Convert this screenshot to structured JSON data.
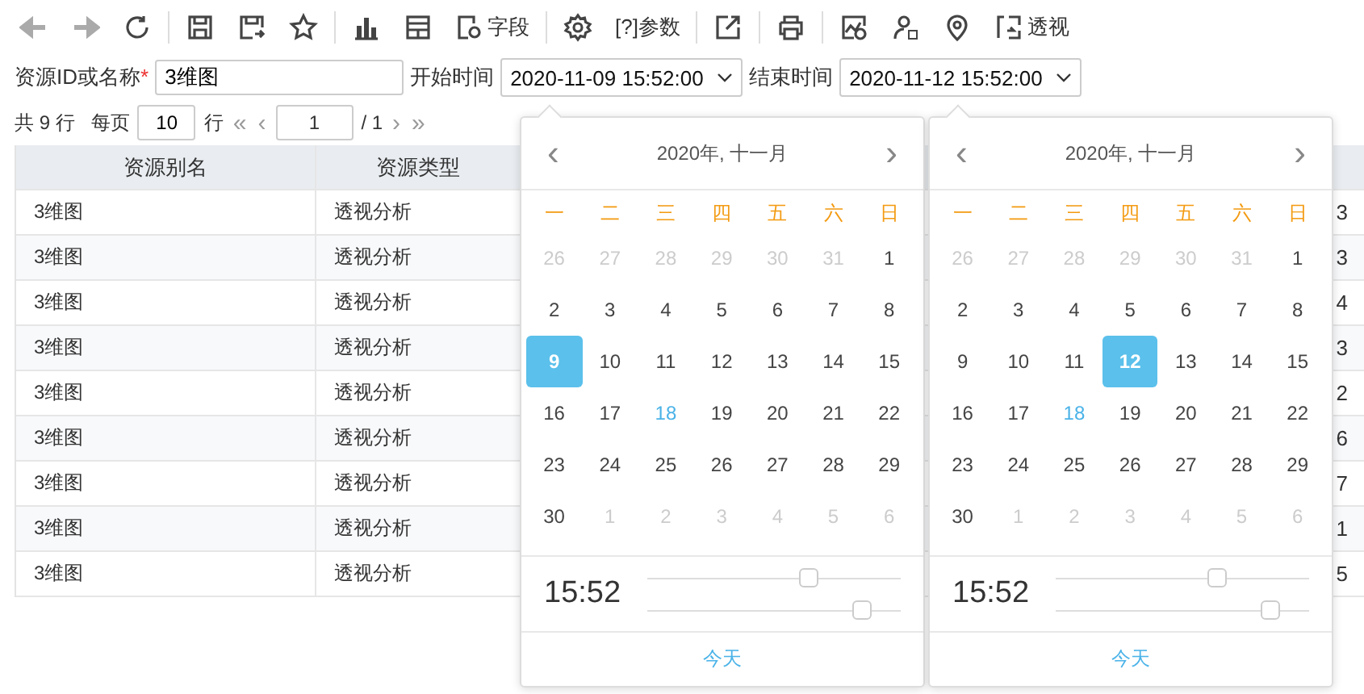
{
  "toolbar": [
    {
      "kind": "back",
      "disabled": true
    },
    {
      "kind": "forward",
      "disabled": true
    },
    {
      "kind": "refresh",
      "disabled": false
    },
    {
      "kind": "save",
      "disabled": false
    },
    {
      "kind": "save-as",
      "disabled": false
    },
    {
      "kind": "star",
      "disabled": false
    },
    {
      "kind": "bar-chart",
      "disabled": false
    },
    {
      "kind": "layout",
      "disabled": false
    },
    {
      "kind": "fields",
      "label": "字段",
      "disabled": false
    },
    {
      "kind": "gear",
      "disabled": false
    },
    {
      "kind": "params",
      "label": "[?]参数",
      "disabled": false
    },
    {
      "kind": "export",
      "disabled": false
    },
    {
      "kind": "print",
      "disabled": false
    },
    {
      "kind": "chart-clock",
      "disabled": false
    },
    {
      "kind": "user-help",
      "disabled": false
    },
    {
      "kind": "pin",
      "disabled": false
    },
    {
      "kind": "pivot",
      "label": "透视",
      "disabled": false
    }
  ],
  "filters": {
    "name_label": "资源ID或名称",
    "required_mark": "*",
    "name_value": "3维图",
    "start_label": "开始时间",
    "start_value": "2020-11-09 15:52:00",
    "end_label": "结束时间",
    "end_value": "2020-11-12 15:52:00"
  },
  "pager": {
    "total": "共 9 行",
    "per_page_label": "每页",
    "per_page": "10",
    "rows_label": "行",
    "first": "«",
    "prev": "‹",
    "page": "1",
    "of": "/ 1",
    "next": "›",
    "last": "»"
  },
  "table": {
    "columns": [
      "资源别名",
      "资源类型"
    ],
    "rows": [
      {
        "alias": "3维图",
        "type": "透视分析",
        "column_4": "3"
      },
      {
        "alias": "3维图",
        "type": "透视分析",
        "column_4": "3"
      },
      {
        "alias": "3维图",
        "type": "透视分析",
        "column_4": "4"
      },
      {
        "alias": "3维图",
        "type": "透视分析",
        "column_4": "3"
      },
      {
        "alias": "3维图",
        "type": "透视分析",
        "column_4": "2"
      },
      {
        "alias": "3维图",
        "type": "透视分析",
        "column_4": "6"
      },
      {
        "alias": "3维图",
        "type": "透视分析",
        "column_4": "7"
      },
      {
        "alias": "3维图",
        "type": "透视分析",
        "column_4": "1"
      },
      {
        "alias": "3维图",
        "type": "透视分析",
        "column_4": "5"
      }
    ]
  },
  "calendars": [
    {
      "prev": "‹",
      "title": "2020年, 十一月",
      "next": "›",
      "weekdays": [
        "一",
        "二",
        "三",
        "四",
        "五",
        "六",
        "日"
      ],
      "days": [
        {
          "label": "26",
          "muted": true,
          "selected": false,
          "today": false
        },
        {
          "label": "27",
          "muted": true,
          "selected": false,
          "today": false
        },
        {
          "label": "28",
          "muted": true,
          "selected": false,
          "today": false
        },
        {
          "label": "29",
          "muted": true,
          "selected": false,
          "today": false
        },
        {
          "label": "30",
          "muted": true,
          "selected": false,
          "today": false
        },
        {
          "label": "31",
          "muted": true,
          "selected": false,
          "today": false
        },
        {
          "label": "1",
          "muted": false,
          "selected": false,
          "today": false
        },
        {
          "label": "2",
          "muted": false,
          "selected": false,
          "today": false
        },
        {
          "label": "3",
          "muted": false,
          "selected": false,
          "today": false
        },
        {
          "label": "4",
          "muted": false,
          "selected": false,
          "today": false
        },
        {
          "label": "5",
          "muted": false,
          "selected": false,
          "today": false
        },
        {
          "label": "6",
          "muted": false,
          "selected": false,
          "today": false
        },
        {
          "label": "7",
          "muted": false,
          "selected": false,
          "today": false
        },
        {
          "label": "8",
          "muted": false,
          "selected": false,
          "today": false
        },
        {
          "label": "9",
          "muted": false,
          "selected": true,
          "today": false
        },
        {
          "label": "10",
          "muted": false,
          "selected": false,
          "today": false
        },
        {
          "label": "11",
          "muted": false,
          "selected": false,
          "today": false
        },
        {
          "label": "12",
          "muted": false,
          "selected": false,
          "today": false
        },
        {
          "label": "13",
          "muted": false,
          "selected": false,
          "today": false
        },
        {
          "label": "14",
          "muted": false,
          "selected": false,
          "today": false
        },
        {
          "label": "15",
          "muted": false,
          "selected": false,
          "today": false
        },
        {
          "label": "16",
          "muted": false,
          "selected": false,
          "today": false
        },
        {
          "label": "17",
          "muted": false,
          "selected": false,
          "today": false
        },
        {
          "label": "18",
          "muted": false,
          "selected": false,
          "today": true
        },
        {
          "label": "19",
          "muted": false,
          "selected": false,
          "today": false
        },
        {
          "label": "20",
          "muted": false,
          "selected": false,
          "today": false
        },
        {
          "label": "21",
          "muted": false,
          "selected": false,
          "today": false
        },
        {
          "label": "22",
          "muted": false,
          "selected": false,
          "today": false
        },
        {
          "label": "23",
          "muted": false,
          "selected": false,
          "today": false
        },
        {
          "label": "24",
          "muted": false,
          "selected": false,
          "today": false
        },
        {
          "label": "25",
          "muted": false,
          "selected": false,
          "today": false
        },
        {
          "label": "26",
          "muted": false,
          "selected": false,
          "today": false
        },
        {
          "label": "27",
          "muted": false,
          "selected": false,
          "today": false
        },
        {
          "label": "28",
          "muted": false,
          "selected": false,
          "today": false
        },
        {
          "label": "29",
          "muted": false,
          "selected": false,
          "today": false
        },
        {
          "label": "30",
          "muted": false,
          "selected": false,
          "today": false
        },
        {
          "label": "1",
          "muted": true,
          "selected": false,
          "today": false
        },
        {
          "label": "2",
          "muted": true,
          "selected": false,
          "today": false
        },
        {
          "label": "3",
          "muted": true,
          "selected": false,
          "today": false
        },
        {
          "label": "4",
          "muted": true,
          "selected": false,
          "today": false
        },
        {
          "label": "5",
          "muted": true,
          "selected": false,
          "today": false
        },
        {
          "label": "6",
          "muted": true,
          "selected": false,
          "today": false
        }
      ],
      "time": "15:52",
      "hour": {
        "level": 0.64
      },
      "minute": {
        "level": 0.85
      },
      "today_button": "今天"
    },
    {
      "prev": "‹",
      "title": "2020年, 十一月",
      "next": "›",
      "weekdays": [
        "一",
        "二",
        "三",
        "四",
        "五",
        "六",
        "日"
      ],
      "days": [
        {
          "label": "26",
          "muted": true,
          "selected": false,
          "today": false
        },
        {
          "label": "27",
          "muted": true,
          "selected": false,
          "today": false
        },
        {
          "label": "28",
          "muted": true,
          "selected": false,
          "today": false
        },
        {
          "label": "29",
          "muted": true,
          "selected": false,
          "today": false
        },
        {
          "label": "30",
          "muted": true,
          "selected": false,
          "today": false
        },
        {
          "label": "31",
          "muted": true,
          "selected": false,
          "today": false
        },
        {
          "label": "1",
          "muted": false,
          "selected": false,
          "today": false
        },
        {
          "label": "2",
          "muted": false,
          "selected": false,
          "today": false
        },
        {
          "label": "3",
          "muted": false,
          "selected": false,
          "today": false
        },
        {
          "label": "4",
          "muted": false,
          "selected": false,
          "today": false
        },
        {
          "label": "5",
          "muted": false,
          "selected": false,
          "today": false
        },
        {
          "label": "6",
          "muted": false,
          "selected": false,
          "today": false
        },
        {
          "label": "7",
          "muted": false,
          "selected": false,
          "today": false
        },
        {
          "label": "8",
          "muted": false,
          "selected": false,
          "today": false
        },
        {
          "label": "9",
          "muted": false,
          "selected": false,
          "today": false
        },
        {
          "label": "10",
          "muted": false,
          "selected": false,
          "today": false
        },
        {
          "label": "11",
          "muted": false,
          "selected": false,
          "today": false
        },
        {
          "label": "12",
          "muted": false,
          "selected": true,
          "today": false
        },
        {
          "label": "13",
          "muted": false,
          "selected": false,
          "today": false
        },
        {
          "label": "14",
          "muted": false,
          "selected": false,
          "today": false
        },
        {
          "label": "15",
          "muted": false,
          "selected": false,
          "today": false
        },
        {
          "label": "16",
          "muted": false,
          "selected": false,
          "today": false
        },
        {
          "label": "17",
          "muted": false,
          "selected": false,
          "today": false
        },
        {
          "label": "18",
          "muted": false,
          "selected": false,
          "today": true
        },
        {
          "label": "19",
          "muted": false,
          "selected": false,
          "today": false
        },
        {
          "label": "20",
          "muted": false,
          "selected": false,
          "today": false
        },
        {
          "label": "21",
          "muted": false,
          "selected": false,
          "today": false
        },
        {
          "label": "22",
          "muted": false,
          "selected": false,
          "today": false
        },
        {
          "label": "23",
          "muted": false,
          "selected": false,
          "today": false
        },
        {
          "label": "24",
          "muted": false,
          "selected": false,
          "today": false
        },
        {
          "label": "25",
          "muted": false,
          "selected": false,
          "today": false
        },
        {
          "label": "26",
          "muted": false,
          "selected": false,
          "today": false
        },
        {
          "label": "27",
          "muted": false,
          "selected": false,
          "today": false
        },
        {
          "label": "28",
          "muted": false,
          "selected": false,
          "today": false
        },
        {
          "label": "29",
          "muted": false,
          "selected": false,
          "today": false
        },
        {
          "label": "30",
          "muted": false,
          "selected": false,
          "today": false
        },
        {
          "label": "1",
          "muted": true,
          "selected": false,
          "today": false
        },
        {
          "label": "2",
          "muted": true,
          "selected": false,
          "today": false
        },
        {
          "label": "3",
          "muted": true,
          "selected": false,
          "today": false
        },
        {
          "label": "4",
          "muted": true,
          "selected": false,
          "today": false
        },
        {
          "label": "5",
          "muted": true,
          "selected": false,
          "today": false
        },
        {
          "label": "6",
          "muted": true,
          "selected": false,
          "today": false
        }
      ],
      "time": "15:52",
      "hour": {
        "level": 0.64
      },
      "minute": {
        "level": 0.85
      },
      "today_button": "今天"
    }
  ]
}
